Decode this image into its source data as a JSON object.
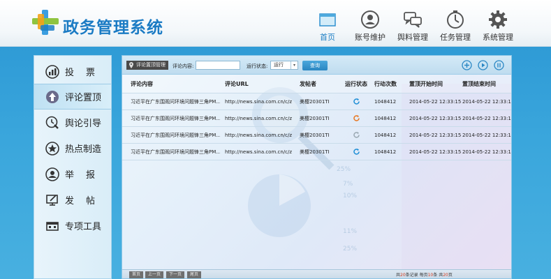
{
  "app": {
    "title": "政务管理系统"
  },
  "nav": [
    {
      "label": "首页",
      "icon": "home-window-icon"
    },
    {
      "label": "账号维护",
      "icon": "user-icon"
    },
    {
      "label": "舆料管理",
      "icon": "chat-bubbles-icon"
    },
    {
      "label": "任务管理",
      "icon": "clock-icon"
    },
    {
      "label": "系统管理",
      "icon": "gear-icon"
    }
  ],
  "sidebar": {
    "items": [
      {
        "label": "投票",
        "icon": "vote-chart-icon"
      },
      {
        "label": "评论置顶",
        "icon": "pin-top-icon"
      },
      {
        "label": "舆论引导",
        "icon": "guide-icon"
      },
      {
        "label": "热点制造",
        "icon": "star-icon"
      },
      {
        "label": "举报",
        "icon": "report-icon"
      },
      {
        "label": "发帖",
        "icon": "post-icon"
      },
      {
        "label": "专项工具",
        "icon": "toolbox-icon"
      }
    ]
  },
  "toolbar": {
    "tab_title": "评论置顶管理",
    "content_label": "评论内容:",
    "content_value": "",
    "status_label": "运行状态:",
    "status_value": "运行",
    "query_label": "查询"
  },
  "table": {
    "columns": [
      "评论内容",
      "评论URL",
      "发帖者",
      "运行状态",
      "行动次数",
      "置顶开始时间",
      "置顶结束时间"
    ],
    "rows": [
      {
        "content": "习近平在广东围观问环境问题锋三角PM...",
        "url": "http://news.sina.com.cn/c/z",
        "author": "美樱20301TI",
        "status": "running",
        "count": "1048412",
        "start": "2014-05-22 12:33:15",
        "end": "2014-05-22 12:33:15"
      },
      {
        "content": "习近平在广东围观问环境问题锋三角PM...",
        "url": "http://news.sina.com.cn/c/z",
        "author": "美樱20301TI",
        "status": "paused",
        "count": "1048412",
        "start": "2014-05-22 12:33:15",
        "end": "2014-05-22 12:33:15"
      },
      {
        "content": "习近平在广东围观问环境问题锋三角PM...",
        "url": "http://news.sina.com.cn/c/z",
        "author": "美樱20301TI",
        "status": "stopped",
        "count": "1048412",
        "start": "2014-05-22 12:33:15",
        "end": "2014-05-22 12:33:15"
      },
      {
        "content": "习近平在广东围观问环境问题锋三角PM...",
        "url": "http://news.sina.com.cn/c/z",
        "author": "美樱20301TI",
        "status": "running",
        "count": "1048412",
        "start": "2014-05-22 12:33:15",
        "end": "2014-05-22 12:33:15"
      }
    ]
  },
  "pager": {
    "first": "首页",
    "prev": "上一页",
    "next": "下一页",
    "last": "尾页",
    "total_pre": "共",
    "total_records": "20",
    "total_post": "条记录",
    "per_pre": "每页",
    "per_page": "10",
    "per_post": "条",
    "pages_pre": "共",
    "pages": "20",
    "pages_post": "页"
  },
  "background_labels": [
    "25%",
    "7%",
    "10%",
    "11%",
    "25%"
  ],
  "colors": {
    "accent": "#1c7ec4",
    "band": "#3aa3d8",
    "status_running": "#1f8fd6",
    "status_paused": "#e87722",
    "status_stopped": "#9aa8b2"
  }
}
